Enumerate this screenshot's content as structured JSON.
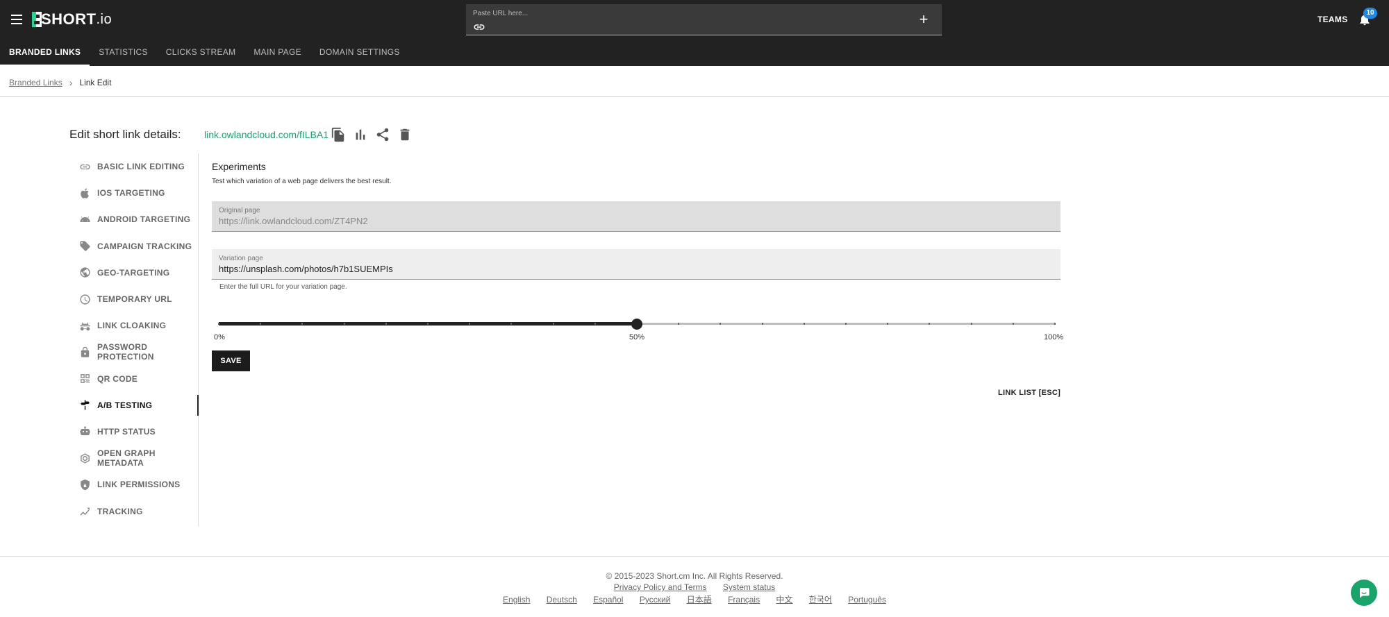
{
  "header": {
    "logo_text": "SHORT",
    "logo_suffix": ".io",
    "paste_placeholder": "Paste URL here...",
    "teams_label": "TEAMS",
    "notification_count": "10",
    "tabs": [
      {
        "label": "BRANDED LINKS",
        "active": true
      },
      {
        "label": "STATISTICS"
      },
      {
        "label": "CLICKS STREAM"
      },
      {
        "label": "MAIN PAGE"
      },
      {
        "label": "DOMAIN SETTINGS"
      }
    ]
  },
  "breadcrumb": {
    "parent": "Branded Links",
    "current": "Link Edit"
  },
  "edit": {
    "title": "Edit short link details:",
    "short_link": "link.owlandcloud.com/fILBA1"
  },
  "sidebar": {
    "items": [
      {
        "label": "BASIC LINK EDITING",
        "icon": "link-icon"
      },
      {
        "label": "IOS TARGETING",
        "icon": "apple-icon"
      },
      {
        "label": "ANDROID TARGETING",
        "icon": "android-icon"
      },
      {
        "label": "CAMPAIGN TRACKING",
        "icon": "tag-icon"
      },
      {
        "label": "GEO-TARGETING",
        "icon": "globe-icon"
      },
      {
        "label": "TEMPORARY URL",
        "icon": "clock-icon"
      },
      {
        "label": "LINK CLOAKING",
        "icon": "incognito-icon"
      },
      {
        "label": "PASSWORD PROTECTION",
        "icon": "lock-icon"
      },
      {
        "label": "QR CODE",
        "icon": "qr-code-icon"
      },
      {
        "label": "A/B TESTING",
        "icon": "signpost-icon",
        "active": true
      },
      {
        "label": "HTTP STATUS",
        "icon": "robot-icon"
      },
      {
        "label": "OPEN GRAPH METADATA",
        "icon": "graph-icon"
      },
      {
        "label": "LINK PERMISSIONS",
        "icon": "shield-lock-icon"
      },
      {
        "label": "TRACKING",
        "icon": "trending-icon"
      }
    ]
  },
  "experiments": {
    "title": "Experiments",
    "description": "Test which variation of a web page delivers the best result.",
    "original_label": "Original page",
    "original_value": "https://link.owlandcloud.com/ZT4PN2",
    "variation_label": "Variation page",
    "variation_value": "https://unsplash.com/photos/h7b1SUEMPIs",
    "variation_helper": "Enter the full URL for your variation page.",
    "slider": {
      "value_percent": 50,
      "min_label": "0%",
      "mid_label": "50%",
      "max_label": "100%",
      "step_percent": 5
    },
    "save_label": "SAVE",
    "link_list_label": "LINK LIST [ESC]"
  },
  "footer": {
    "copyright": "© 2015-2023  Short.cm Inc. All Rights Reserved.",
    "privacy": "Privacy Policy and Terms",
    "status": "System status",
    "languages": [
      "English",
      "Deutsch",
      "Español",
      "Русский",
      "日本語",
      "Français",
      "中文",
      "한국어",
      "Português"
    ]
  },
  "colors": {
    "topbar": "#222222",
    "accent_green": "#1aa36a",
    "badge_blue": "#1e88e5"
  }
}
